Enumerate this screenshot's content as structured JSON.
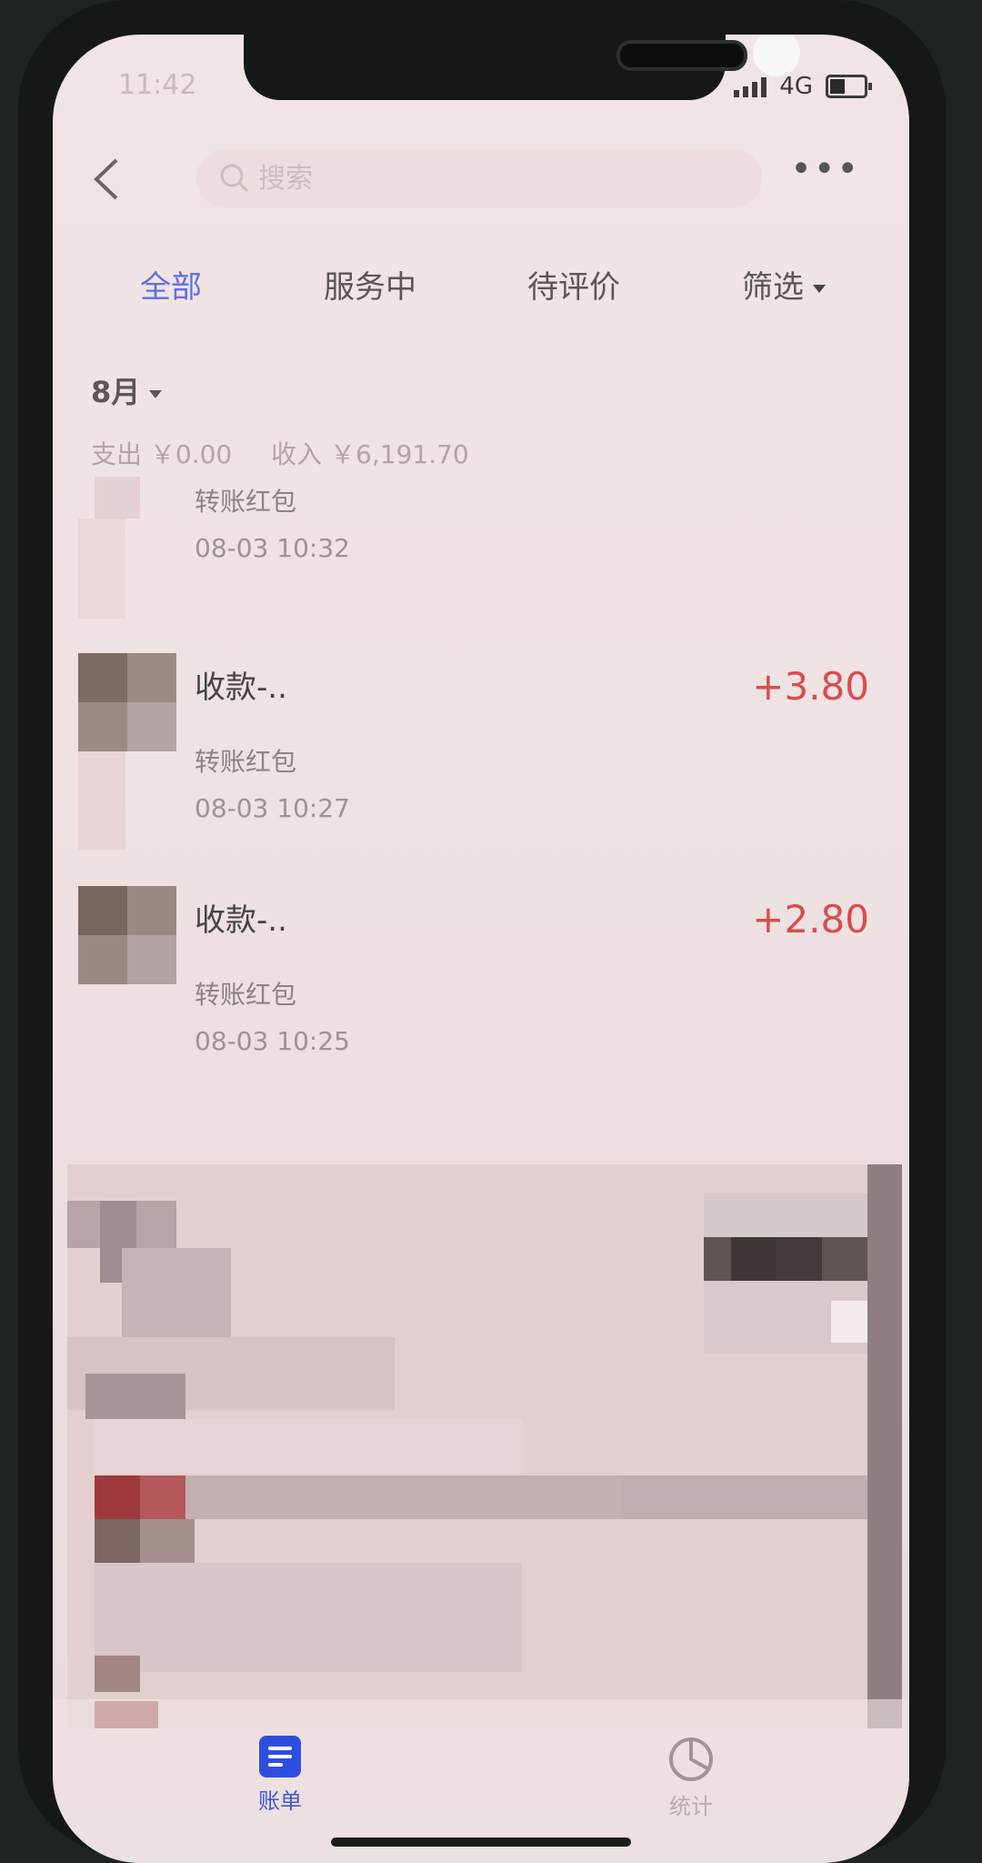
{
  "status_bar": {
    "time": "11:42",
    "network": "4G"
  },
  "nav": {
    "search_placeholder": "搜索"
  },
  "tabs": [
    {
      "label": "全部",
      "active": true
    },
    {
      "label": "服务中",
      "active": false
    },
    {
      "label": "待评价",
      "active": false
    },
    {
      "label": "筛选",
      "active": false
    }
  ],
  "month": "8月",
  "summary": {
    "expense": "支出 ￥0.00",
    "income": "收入 ￥6,191.70"
  },
  "transactions": [
    {
      "title": "",
      "subtitle": "转账红包",
      "time": "08-03  10:32",
      "amount": ""
    },
    {
      "title": "收款-..",
      "subtitle": "转账红包",
      "time": "08-03  10:27",
      "amount": "+3.80"
    },
    {
      "title": "收款-..",
      "subtitle": "转账红包",
      "time": "08-03  10:25",
      "amount": "+2.80"
    }
  ],
  "tabbar": {
    "bill_label": "账单",
    "stats_label": "统计"
  },
  "colors": {
    "accent": "#5e6fe0",
    "amount_positive": "#d74e4f",
    "tab_icon_active": "#2f4ee0"
  }
}
